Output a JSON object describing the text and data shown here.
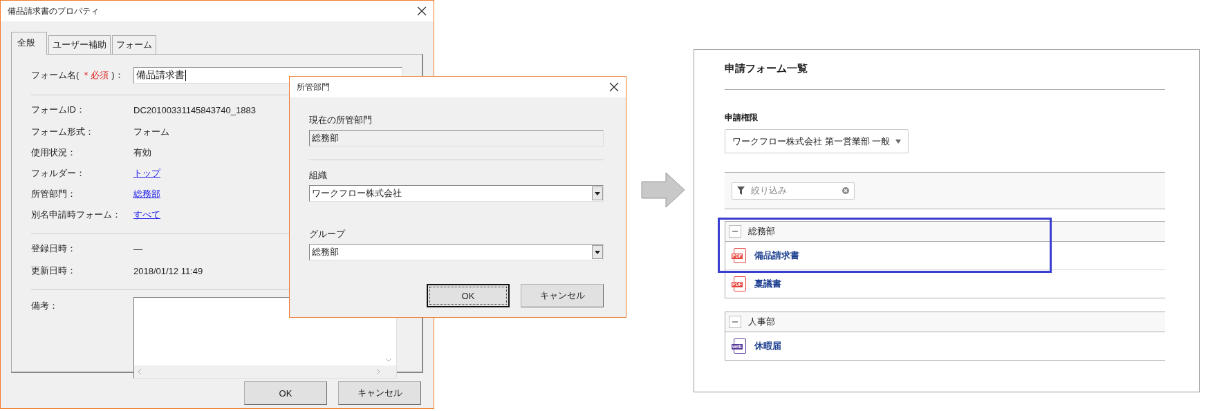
{
  "main_dialog": {
    "title": "備品請求書のプロパティ",
    "tabs": [
      {
        "label": "全般",
        "selected": true
      },
      {
        "label": "ユーザー補助",
        "selected": false
      },
      {
        "label": "フォーム",
        "selected": false
      }
    ],
    "form_name": {
      "label": "フォーム名(",
      "required": "＊必須",
      "suffix": ")：",
      "value": "備品請求書"
    },
    "sections": [
      {
        "rows": [
          {
            "label": "フォームID：",
            "value": "DC20100331145843740_1883",
            "link": false
          },
          {
            "label": "フォーム形式：",
            "value": "フォーム",
            "link": false
          },
          {
            "label": "使用状況：",
            "value": "有効",
            "link": false
          },
          {
            "label": "フォルダー：",
            "value": "トップ",
            "link": true
          },
          {
            "label": "所管部門：",
            "value": "総務部",
            "link": true
          },
          {
            "label": "別名申請時フォーム：",
            "value": "すべて",
            "link": true
          }
        ]
      },
      {
        "rows": [
          {
            "label": "登録日時：",
            "value": "—",
            "link": false
          },
          {
            "label": "更新日時：",
            "value": "2018/01/12 11:49",
            "link": false
          }
        ]
      }
    ],
    "notes_label": "備考：",
    "buttons": [
      {
        "label": "OK",
        "focused": false
      },
      {
        "label": "キャンセル",
        "focused": false
      }
    ]
  },
  "sub_dialog": {
    "title": "所管部門",
    "current_label": "現在の所管部門",
    "current_value": "総務部",
    "org_label": "組織",
    "org_value": "ワークフロー株式会社",
    "group_label": "グループ",
    "group_value": "総務部",
    "buttons": [
      {
        "label": "OK",
        "focused": true
      },
      {
        "label": "キャンセル",
        "focused": false
      }
    ]
  },
  "form_list": {
    "title": "申請フォーム一覧",
    "permission_label": "申請権限",
    "permission_value": "ワークフロー株式会社 第一営業部 一般",
    "filter_placeholder": "絞り込み",
    "groups": [
      {
        "name": "総務部",
        "expanded": true,
        "items": [
          {
            "name": "備品請求書",
            "kind": "pdf",
            "badge": "PDF",
            "highlighted": true
          },
          {
            "name": "稟議書",
            "kind": "pdf",
            "badge": "PDF",
            "highlighted": false
          }
        ]
      },
      {
        "name": "人事部",
        "expanded": true,
        "items": [
          {
            "name": "休暇届",
            "kind": "web",
            "badge": "web",
            "highlighted": false
          }
        ]
      }
    ]
  }
}
